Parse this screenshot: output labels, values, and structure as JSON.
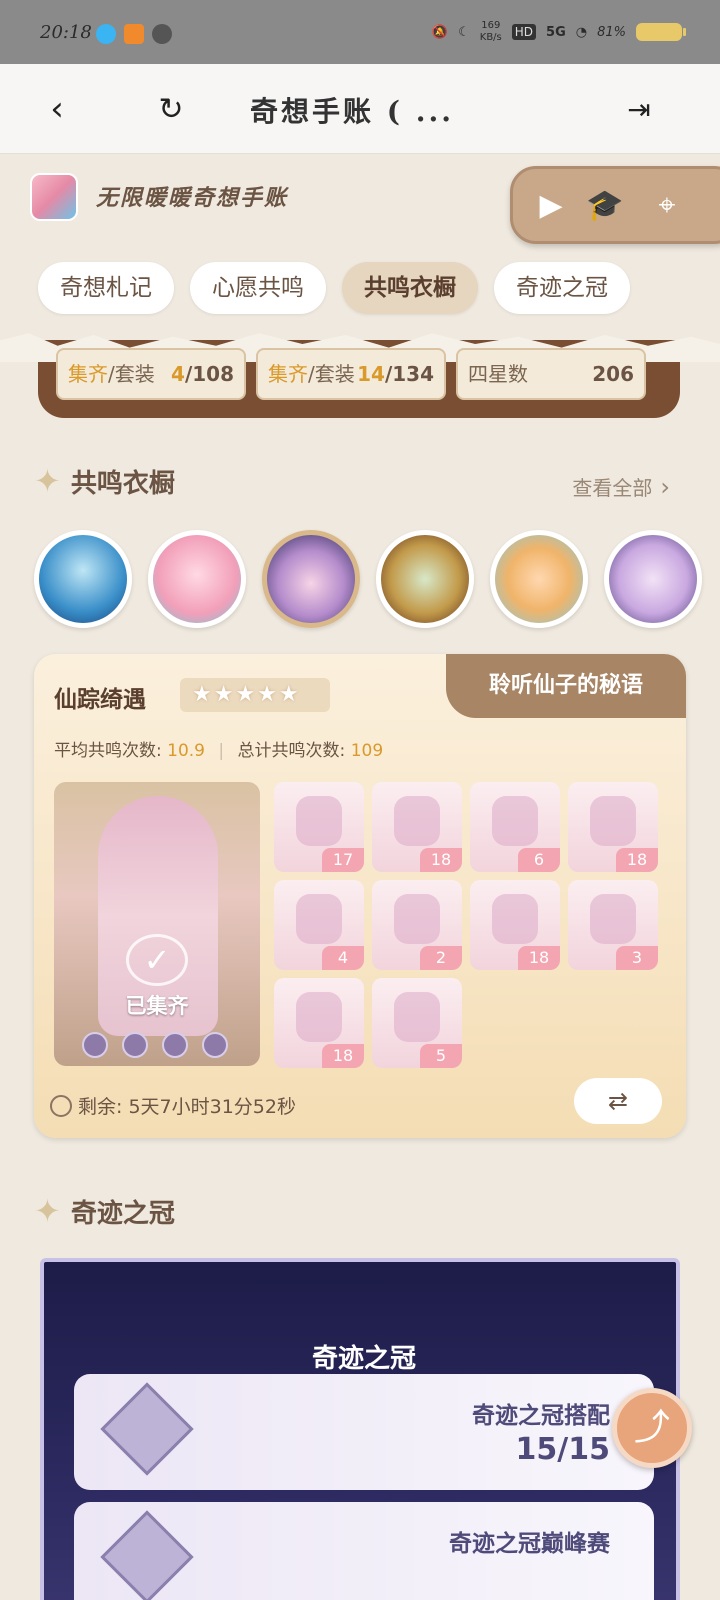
{
  "status_bar": {
    "time": "20:18",
    "network_rate": "169",
    "network_unit": "KB/s",
    "signal": "5G",
    "battery": "81%"
  },
  "nav": {
    "title": "奇想手账 ( ..."
  },
  "header": {
    "app_name": "无限暖暖奇想手账"
  },
  "tabs": [
    {
      "label": "奇想札记"
    },
    {
      "label": "心愿共鸣"
    },
    {
      "label": "共鸣衣橱"
    },
    {
      "label": "奇迹之冠"
    }
  ],
  "summary": {
    "stat1": {
      "hl": "集齐",
      "label": "/套装",
      "value_hl": "4",
      "value_total": "/108"
    },
    "stat2": {
      "hl": "集齐",
      "label": "/套装",
      "value_hl": "14",
      "value_total": "/134"
    },
    "stat3": {
      "label": "四星数",
      "value": "206"
    }
  },
  "wardrobe_section": {
    "title": "共鸣衣橱",
    "see_all": "查看全部"
  },
  "outfit_card": {
    "name": "仙踪绮遇",
    "stars": "★★★★★",
    "banner": "聆听仙子的秘语",
    "avg_label": "平均共鸣次数: ",
    "avg_value": "10.9",
    "total_label": "总计共鸣次数: ",
    "total_value": "109",
    "collected": "已集齐",
    "remaining": "剩余: 5天7小时31分52秒",
    "pieces": [
      {
        "count": "17"
      },
      {
        "count": "18"
      },
      {
        "count": "6"
      },
      {
        "count": "18"
      },
      {
        "count": "4"
      },
      {
        "count": "2"
      },
      {
        "count": "18"
      },
      {
        "count": "3"
      },
      {
        "count": "18"
      },
      {
        "count": "5"
      }
    ]
  },
  "crown_section": {
    "title": "奇迹之冠",
    "panel_title": "奇迹之冠",
    "row1_title": "奇迹之冠搭配",
    "row1_value": "15/15",
    "row2_title": "奇迹之冠巅峰赛"
  },
  "colors": {
    "accent_gold": "#d99a2b",
    "brown_banner": "#a88564",
    "crown_bg": "#2c2a60"
  }
}
